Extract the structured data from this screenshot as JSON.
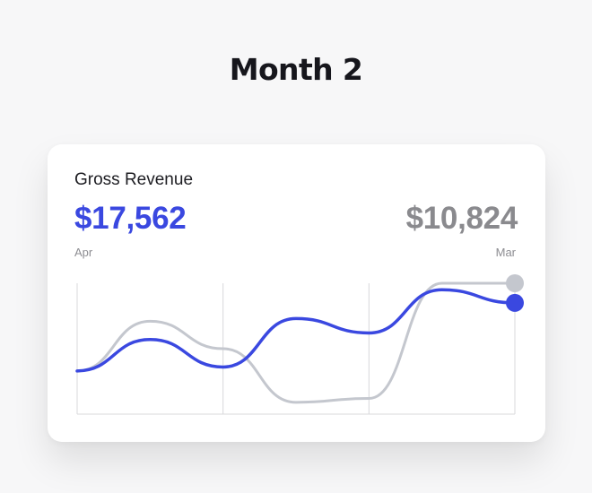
{
  "page": {
    "title": "Month 2"
  },
  "card": {
    "title": "Gross Revenue",
    "current_value": "$17,562",
    "previous_value": "$10,824",
    "current_label": "Apr",
    "previous_label": "Mar"
  },
  "chart_data": {
    "type": "line",
    "grid": true,
    "legend": "none",
    "x": [
      0,
      1,
      2,
      3,
      4,
      5,
      6
    ],
    "ylim": [
      0,
      100
    ],
    "series": [
      {
        "color": "#3a48e0",
        "values": [
          33,
          57,
          36,
          73,
          62,
          95,
          85
        ]
      },
      {
        "color": "#c4c7ce",
        "values": [
          33,
          71,
          50,
          9,
          12,
          100,
          100
        ]
      }
    ]
  },
  "colors": {
    "accent": "#3a48e0",
    "muted": "#8a8a8e",
    "grid": "#d8d8db"
  }
}
